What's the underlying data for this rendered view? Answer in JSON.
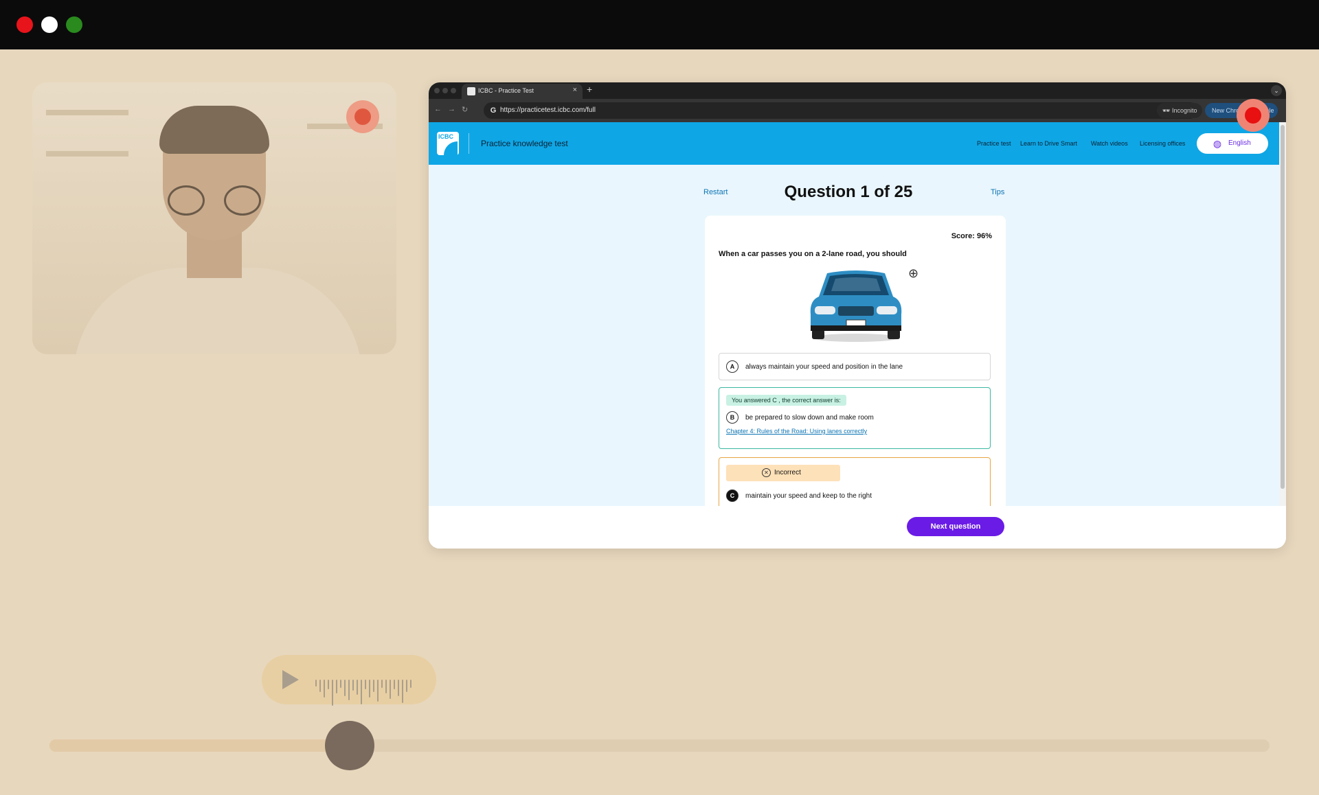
{
  "browser": {
    "tab_title": "ICBC - Practice Test",
    "url": "https://practicetest.icbc.com/full",
    "incognito_label": "Incognito",
    "new_chrome_label": "New Chrome available"
  },
  "site": {
    "logo_text": "ICBC",
    "title": "Practice knowledge test",
    "nav": [
      "Practice test",
      "Learn to Drive Smart",
      "Watch videos",
      "Licensing offices"
    ],
    "language": "English"
  },
  "quiz": {
    "restart_label": "Restart",
    "question_counter": "Question 1 of 25",
    "tips_label": "Tips",
    "score": "Score: 96%",
    "question": "When a car passes you on a 2-lane road, you should",
    "options": [
      {
        "letter": "A",
        "text": "always maintain your speed and position in the lane"
      },
      {
        "letter": "B",
        "text": "be prepared to slow down and make room"
      },
      {
        "letter": "C",
        "text": "maintain your speed and keep to the right"
      }
    ],
    "answered_note": "You answered C , the correct answer is:",
    "chapter_link": "Chapter 4: Rules of the Road: Using lanes correctly",
    "incorrect_label": "Incorrect",
    "next_button": "Next question"
  },
  "media": {
    "seek_progress": 0.246
  },
  "colors": {
    "page_bg": "#e7d7bd",
    "site_header": "#0fa6e5",
    "next_button": "#6a1be6",
    "correct_border": "#39b7a0",
    "incorrect_border": "#e8a542"
  }
}
